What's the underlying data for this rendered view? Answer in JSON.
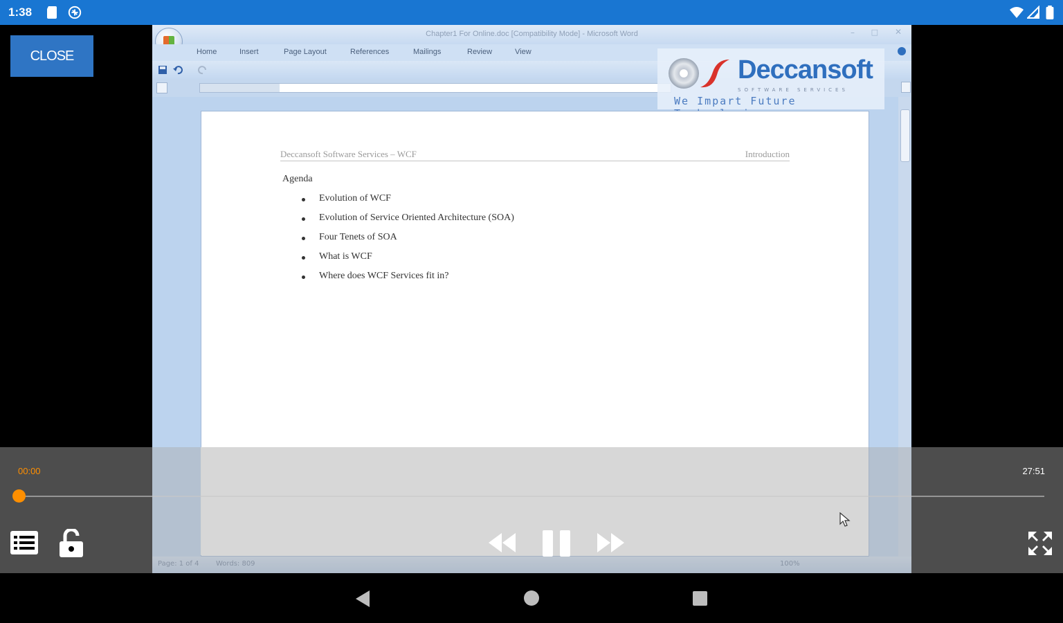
{
  "status_bar": {
    "time": "1:38",
    "left_icons": [
      "sd-card-icon",
      "android-system-icon"
    ],
    "right_icons": [
      "wifi-icon",
      "cell-signal-icon",
      "battery-icon"
    ]
  },
  "close_button": {
    "label": "CLOSE"
  },
  "word_window": {
    "title": "Chapter1 For Online.doc [Compatibility Mode] - Microsoft Word",
    "ribbon_tabs": [
      "Home",
      "Insert",
      "Page Layout",
      "References",
      "Mailings",
      "Review",
      "View"
    ],
    "status": {
      "page": "Page: 1 of 4",
      "words": "Words: 809",
      "zoom": "100%"
    }
  },
  "watermark": {
    "brand": "Deccansoft",
    "sub": "SOFTWARE SERVICES",
    "tagline": "We Impart Future Technologies"
  },
  "document": {
    "header_left": "Deccansoft Software Services – WCF",
    "header_right": "Introduction",
    "agenda_title": "Agenda",
    "agenda_items": [
      "Evolution of WCF",
      "Evolution of Service Oriented Architecture (SOA)",
      "Four Tenets of SOA",
      "What is WCF",
      "Where does WCF Services fit in?"
    ]
  },
  "player": {
    "current_time": "00:00",
    "duration": "27:51",
    "progress": 0.0,
    "accent_color": "#ff8f00"
  }
}
